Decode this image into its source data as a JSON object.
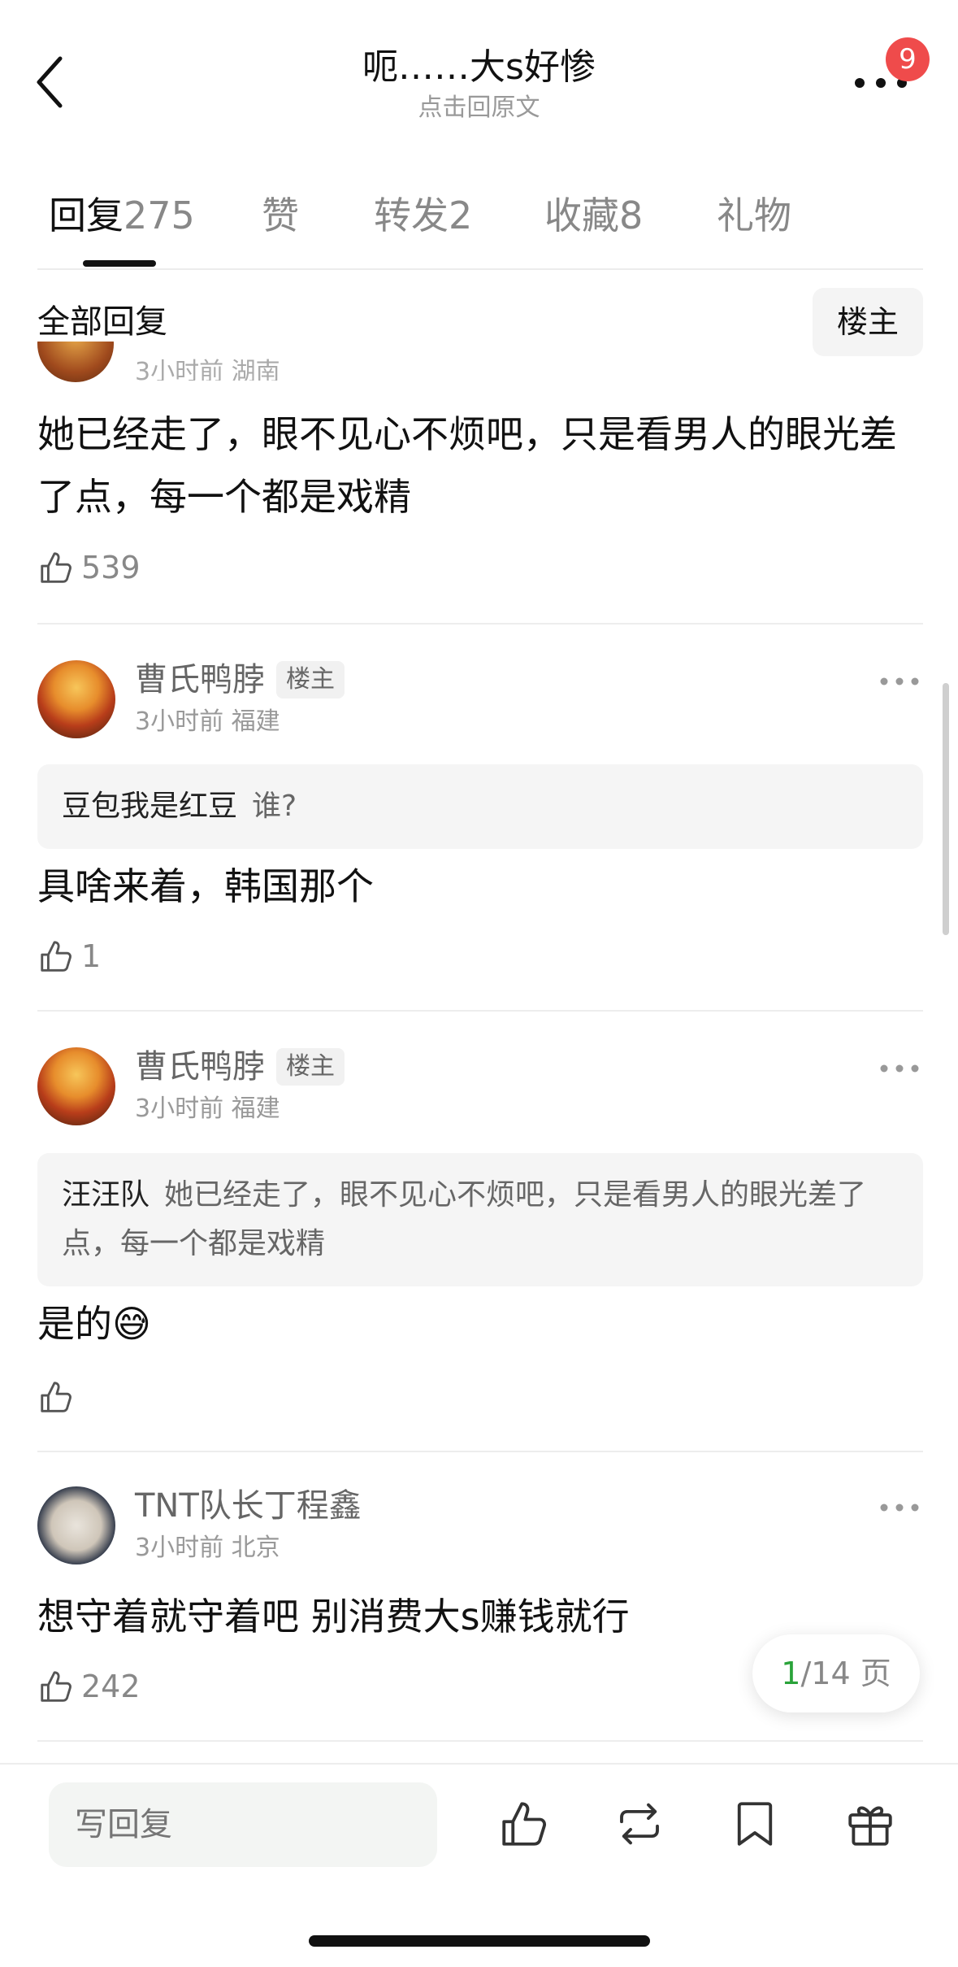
{
  "header": {
    "title": "呃……大s好惨",
    "subtitle": "点击回原文",
    "badge_count": "9"
  },
  "tabs": [
    {
      "label": "回复",
      "count": "275",
      "active": true
    },
    {
      "label": "赞",
      "count": ""
    },
    {
      "label": "转发",
      "count": "2"
    },
    {
      "label": "收藏",
      "count": "8"
    },
    {
      "label": "礼物",
      "count": ""
    }
  ],
  "filter": {
    "label": "全部回复",
    "op_button": "楼主"
  },
  "comments": [
    {
      "partial_meta": "3小时前 湖南",
      "text": "她已经走了，眼不见心不烦吧，只是看男人的眼光差了点，每一个都是戏精",
      "likes": "539"
    },
    {
      "username": "曹氏鸭脖",
      "tag": "楼主",
      "meta": "3小时前 福建",
      "quote_name": "豆包我是红豆",
      "quote_text": "谁?",
      "text": "具啥来着，韩国那个",
      "likes": "1"
    },
    {
      "username": "曹氏鸭脖",
      "tag": "楼主",
      "meta": "3小时前 福建",
      "quote_name": "汪汪队",
      "quote_text": "她已经走了，眼不见心不烦吧，只是看男人的眼光差了点，每一个都是戏精",
      "text": "是的😅",
      "likes": ""
    },
    {
      "username": "TNT队长丁程鑫",
      "meta": "3小时前 北京",
      "text": "想守着就守着吧 别消费大s赚钱就行",
      "likes": "242"
    }
  ],
  "pagination": {
    "current": "1",
    "rest": "/14 页"
  },
  "bottom_bar": {
    "reply_placeholder": "写回复"
  }
}
